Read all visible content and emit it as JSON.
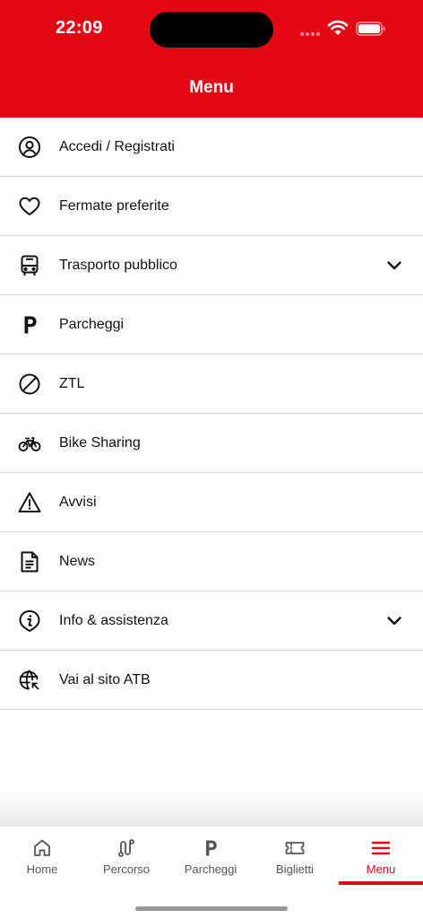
{
  "status_bar": {
    "time": "22:09"
  },
  "header": {
    "title": "Menu"
  },
  "colors": {
    "brand": "#e30613",
    "divider": "#d6d6d6",
    "tab_inactive": "#555555"
  },
  "menu": {
    "items": [
      {
        "label": "Accedi / Registrati",
        "icon": "user-circle-icon"
      },
      {
        "label": "Fermate preferite",
        "icon": "heart-icon"
      },
      {
        "label": "Trasporto pubblico",
        "icon": "bus-icon",
        "expandable": true
      },
      {
        "label": "Parcheggi",
        "icon": "parking-icon"
      },
      {
        "label": "ZTL",
        "icon": "no-entry-icon"
      },
      {
        "label": "Bike Sharing",
        "icon": "bike-icon"
      },
      {
        "label": "Avvisi",
        "icon": "warning-icon"
      },
      {
        "label": "News",
        "icon": "document-icon"
      },
      {
        "label": "Info & assistenza",
        "icon": "info-icon",
        "expandable": true
      },
      {
        "label": "Vai al sito ATB",
        "icon": "globe-link-icon"
      }
    ]
  },
  "tabbar": {
    "tabs": [
      {
        "label": "Home",
        "icon": "home-icon"
      },
      {
        "label": "Percorso",
        "icon": "route-icon"
      },
      {
        "label": "Parcheggi",
        "icon": "parking-icon"
      },
      {
        "label": "Biglietti",
        "icon": "ticket-icon"
      },
      {
        "label": "Menu",
        "icon": "hamburger-icon",
        "active": true
      }
    ]
  }
}
